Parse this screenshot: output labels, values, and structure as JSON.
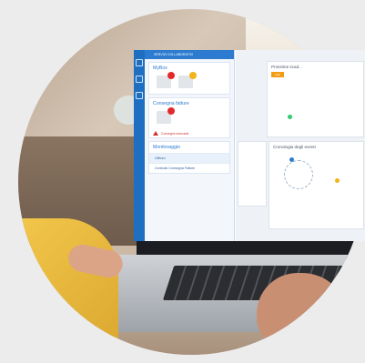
{
  "panel": {
    "header": "SERVIZI COLLABORATIVI",
    "sections": [
      {
        "title": "MyBox"
      },
      {
        "title": "Consegna fatture",
        "alert": "Consegne mancanti"
      },
      {
        "title": "Monitoraggio",
        "items": [
          "Utilizzo",
          "Controllo Consegna Fatture"
        ]
      }
    ]
  },
  "main": {
    "card_right_title": "Prossime scad...",
    "card_right_button": "Vedi",
    "card_bottom_title": "Cronologia degli eventi"
  },
  "colors": {
    "nav": "#1e6fc2",
    "accent": "#2d7bd0",
    "alert_red": "#e2292b",
    "warning_yellow": "#f3b31a",
    "button_orange": "#f39c12"
  }
}
